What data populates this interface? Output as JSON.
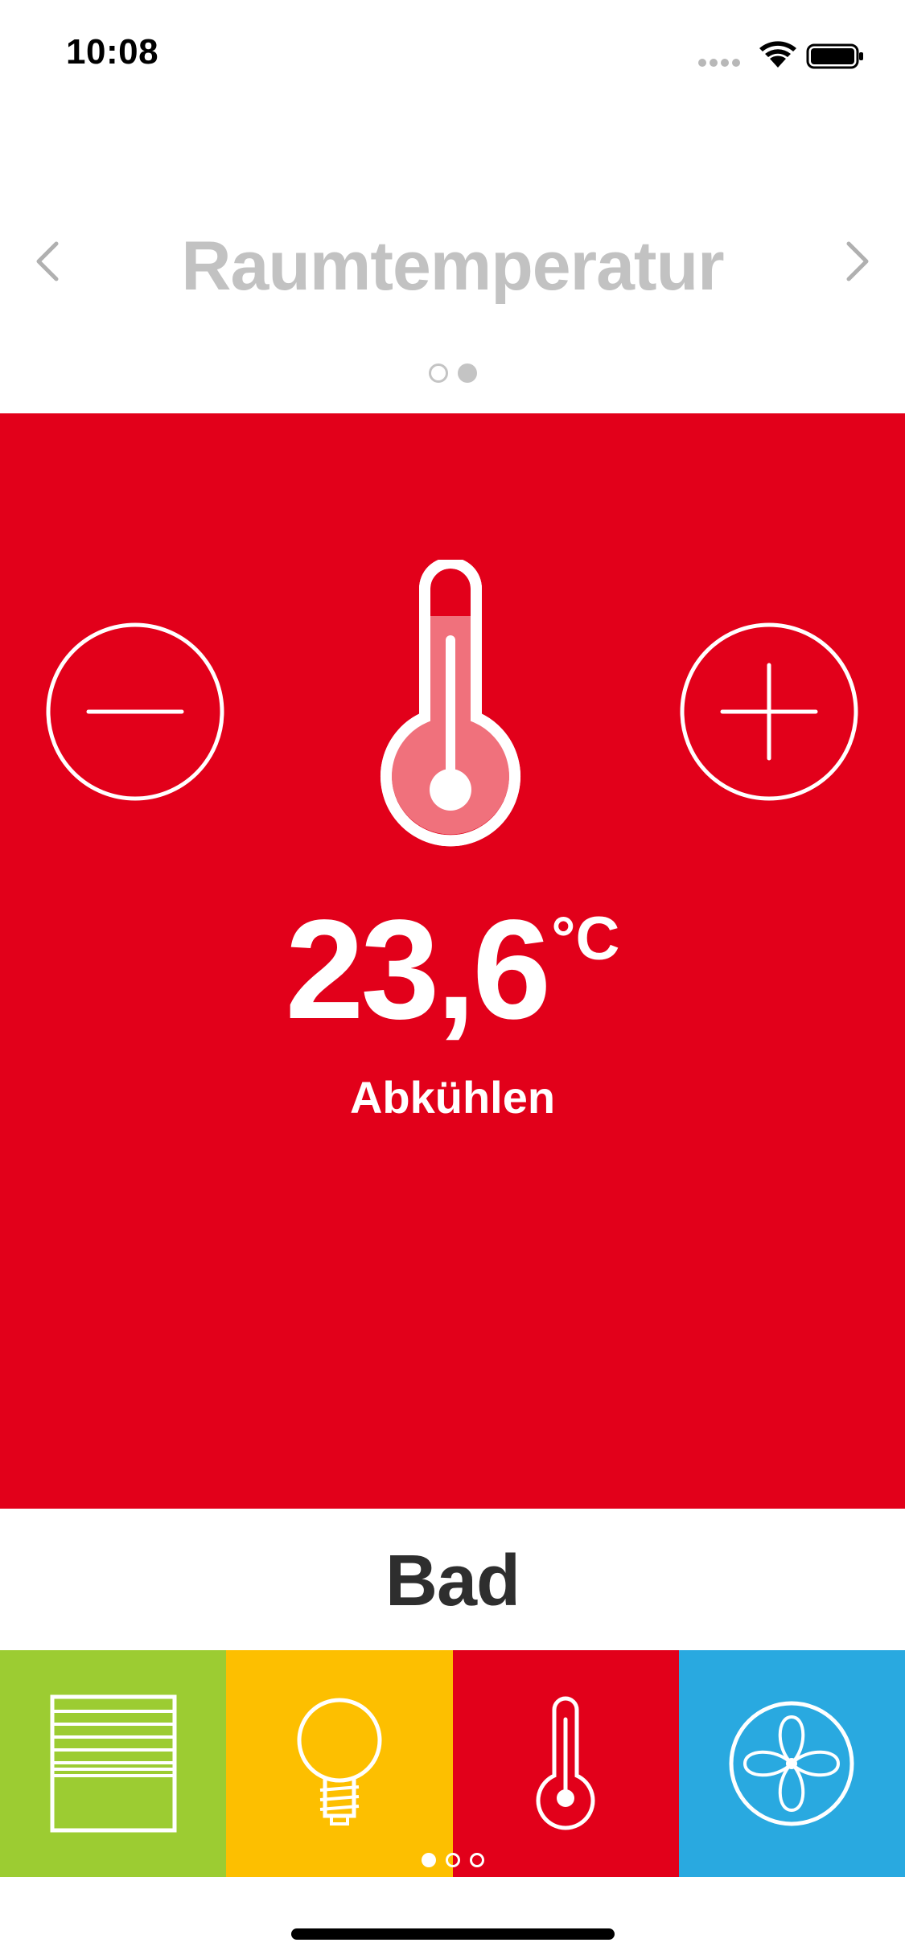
{
  "status_bar": {
    "time": "10:08",
    "icons": [
      "signal-icon",
      "wifi-icon",
      "battery-icon"
    ]
  },
  "header": {
    "title": "Raumtemperatur",
    "prev_icon": "chevron-left-icon",
    "next_icon": "chevron-right-icon",
    "page_count": 2,
    "active_page": 2
  },
  "panel": {
    "color": "#e2001a",
    "temperature": "23,6",
    "unit": "°C",
    "mode": "Abkühlen",
    "minus_icon": "minus-icon",
    "plus_icon": "plus-icon",
    "main_icon": "thermometer-icon"
  },
  "room": {
    "name": "Bad"
  },
  "tiles": [
    {
      "icon": "blinds-icon",
      "color": "#9ccc32"
    },
    {
      "icon": "light-bulb-icon",
      "color": "#fdbf00"
    },
    {
      "icon": "thermometer-icon",
      "color": "#e2001a"
    },
    {
      "icon": "fan-icon",
      "color": "#29a9e0"
    }
  ],
  "tile_pages": {
    "count": 3,
    "active": 1
  }
}
